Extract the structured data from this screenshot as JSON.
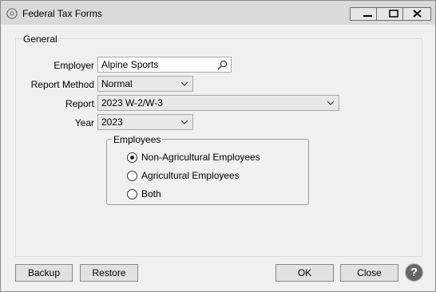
{
  "window": {
    "title": "Federal Tax Forms",
    "icon": "disc-icon"
  },
  "general": {
    "legend": "General",
    "employer": {
      "label": "Employer",
      "value": "Alpine Sports",
      "icon": "search-icon"
    },
    "report_method": {
      "label": "Report Method",
      "value": "Normal"
    },
    "report": {
      "label": "Report",
      "value": "2023 W-2/W-3"
    },
    "year": {
      "label": "Year",
      "value": "2023"
    }
  },
  "employees": {
    "legend": "Employees",
    "options": [
      {
        "label": "Non-Agricultural Employees",
        "selected": true
      },
      {
        "label": "Agricultural Employees",
        "selected": false
      },
      {
        "label": "Both",
        "selected": false
      }
    ]
  },
  "buttons": {
    "backup": "Backup",
    "restore": "Restore",
    "ok": "OK",
    "close": "Close",
    "help": "?"
  }
}
